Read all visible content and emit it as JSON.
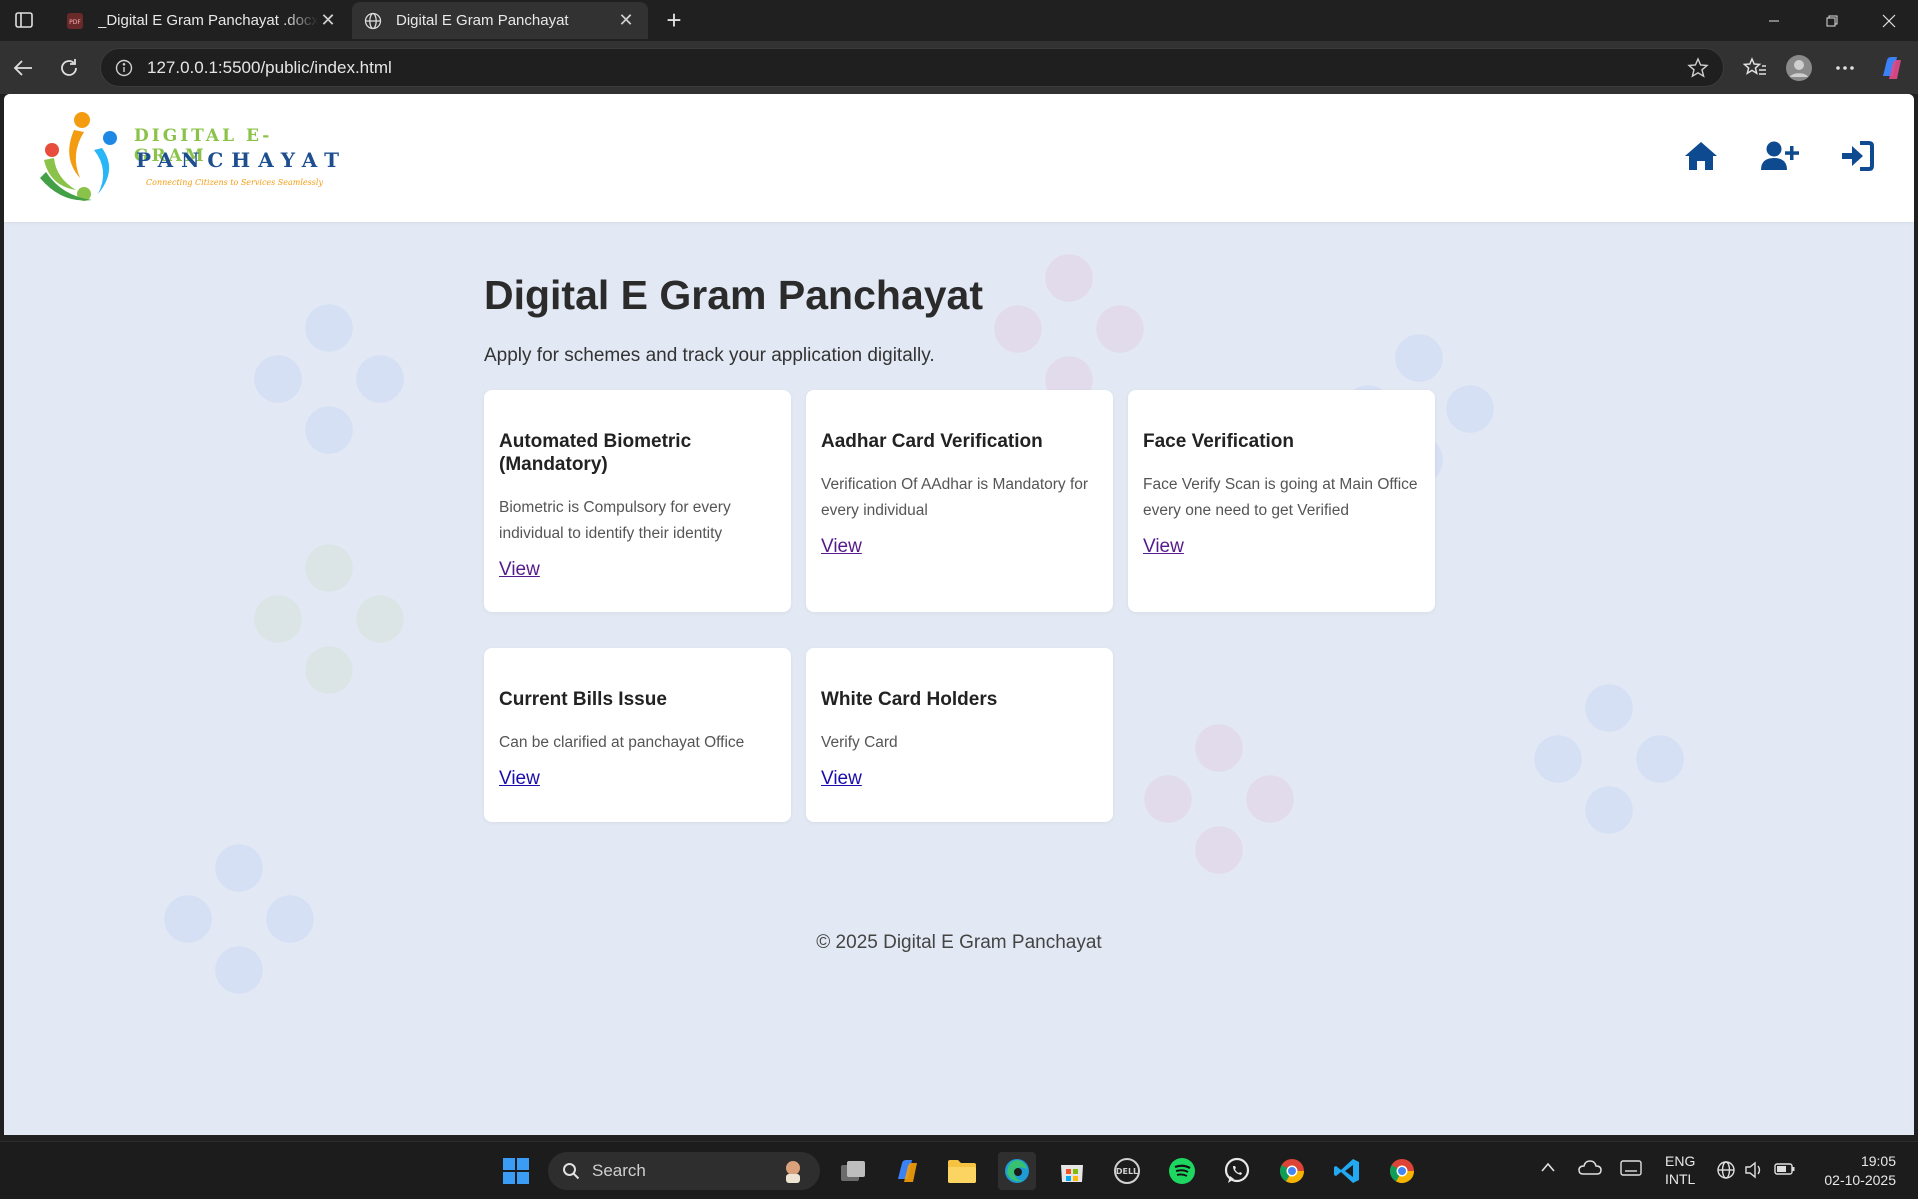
{
  "browser": {
    "tabs": [
      {
        "title": "_Digital E Gram Panchayat .docx.p",
        "active": false,
        "icon": "pdf-icon"
      },
      {
        "title": "Digital E Gram Panchayat",
        "active": true,
        "icon": "globe-icon"
      }
    ],
    "url": "127.0.0.1:5500/public/index.html"
  },
  "site": {
    "logo": {
      "line1": "DIGITAL E-GRAM",
      "line2": "PANCHAYAT",
      "tagline": "Connecting Citizens to Services Seamlessly"
    },
    "nav_icons": [
      "home-icon",
      "user-plus-icon",
      "sign-in-icon"
    ],
    "accent_color": "#0d4a8f",
    "title": "Digital E Gram Panchayat",
    "subtitle": "Apply for schemes and track your application digitally.",
    "cards": [
      {
        "title": "Automated Biometric (Mandatory)",
        "description": "Biometric is Compulsory for every individual to identify their identity",
        "link": "View"
      },
      {
        "title": "Aadhar Card Verification",
        "description": "Verification Of AAdhar is Mandatory for every individual",
        "link": "View"
      },
      {
        "title": "Face Verification",
        "description": "Face Verify Scan is going at Main Office every one need to get Verified",
        "link": "View"
      },
      {
        "title": "Current Bills Issue",
        "description": "Can be clarified at panchayat Office",
        "link": "View"
      },
      {
        "title": "White Card Holders",
        "description": "Verify Card",
        "link": "View"
      }
    ],
    "footer": "© 2025 Digital E Gram Panchayat"
  },
  "taskbar": {
    "search_placeholder": "Search",
    "tray": {
      "lang_line1": "ENG",
      "lang_line2": "INTL",
      "time": "19:05",
      "date": "02-10-2025"
    }
  }
}
